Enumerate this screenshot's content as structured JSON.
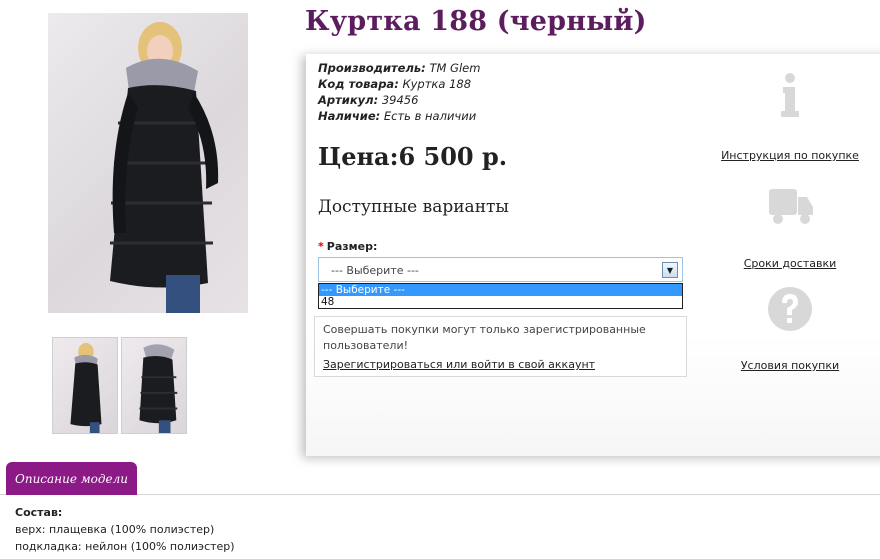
{
  "product": {
    "title": "Куртка 188 (черный)",
    "specs": [
      {
        "label": "Производитель:",
        "value": "TM Glem"
      },
      {
        "label": "Код товара:",
        "value": "Куртка 188"
      },
      {
        "label": "Артикул:",
        "value": "39456"
      },
      {
        "label": "Наличие:",
        "value": "Есть в наличии"
      }
    ],
    "price": "Цена:6 500 р."
  },
  "variants": {
    "title": "Доступные варианты",
    "required_mark": "*",
    "size_label": "Размер:",
    "selected": "--- Выберите ---",
    "options": [
      "--- Выберите ---",
      "48"
    ]
  },
  "notice": {
    "text": "Совершать покупки могут только зарегистрированные пользователи!",
    "link": "Зарегистрироваться или войти в свой аккаунт"
  },
  "info_links": {
    "instruction": "Инструкция по покупке",
    "delivery": "Сроки доставки",
    "conditions": "Условия покупки"
  },
  "description": {
    "tab_label": "Описание модели",
    "heading": "Состав:",
    "lines": [
      "верх: плащевка (100% полиэстер)",
      "подкладка: нейлон (100% полиэстер)"
    ]
  },
  "colors": {
    "title": "#5b1d5e",
    "tab": "#8b1a86",
    "dropdown_highlight": "#3399ff"
  }
}
